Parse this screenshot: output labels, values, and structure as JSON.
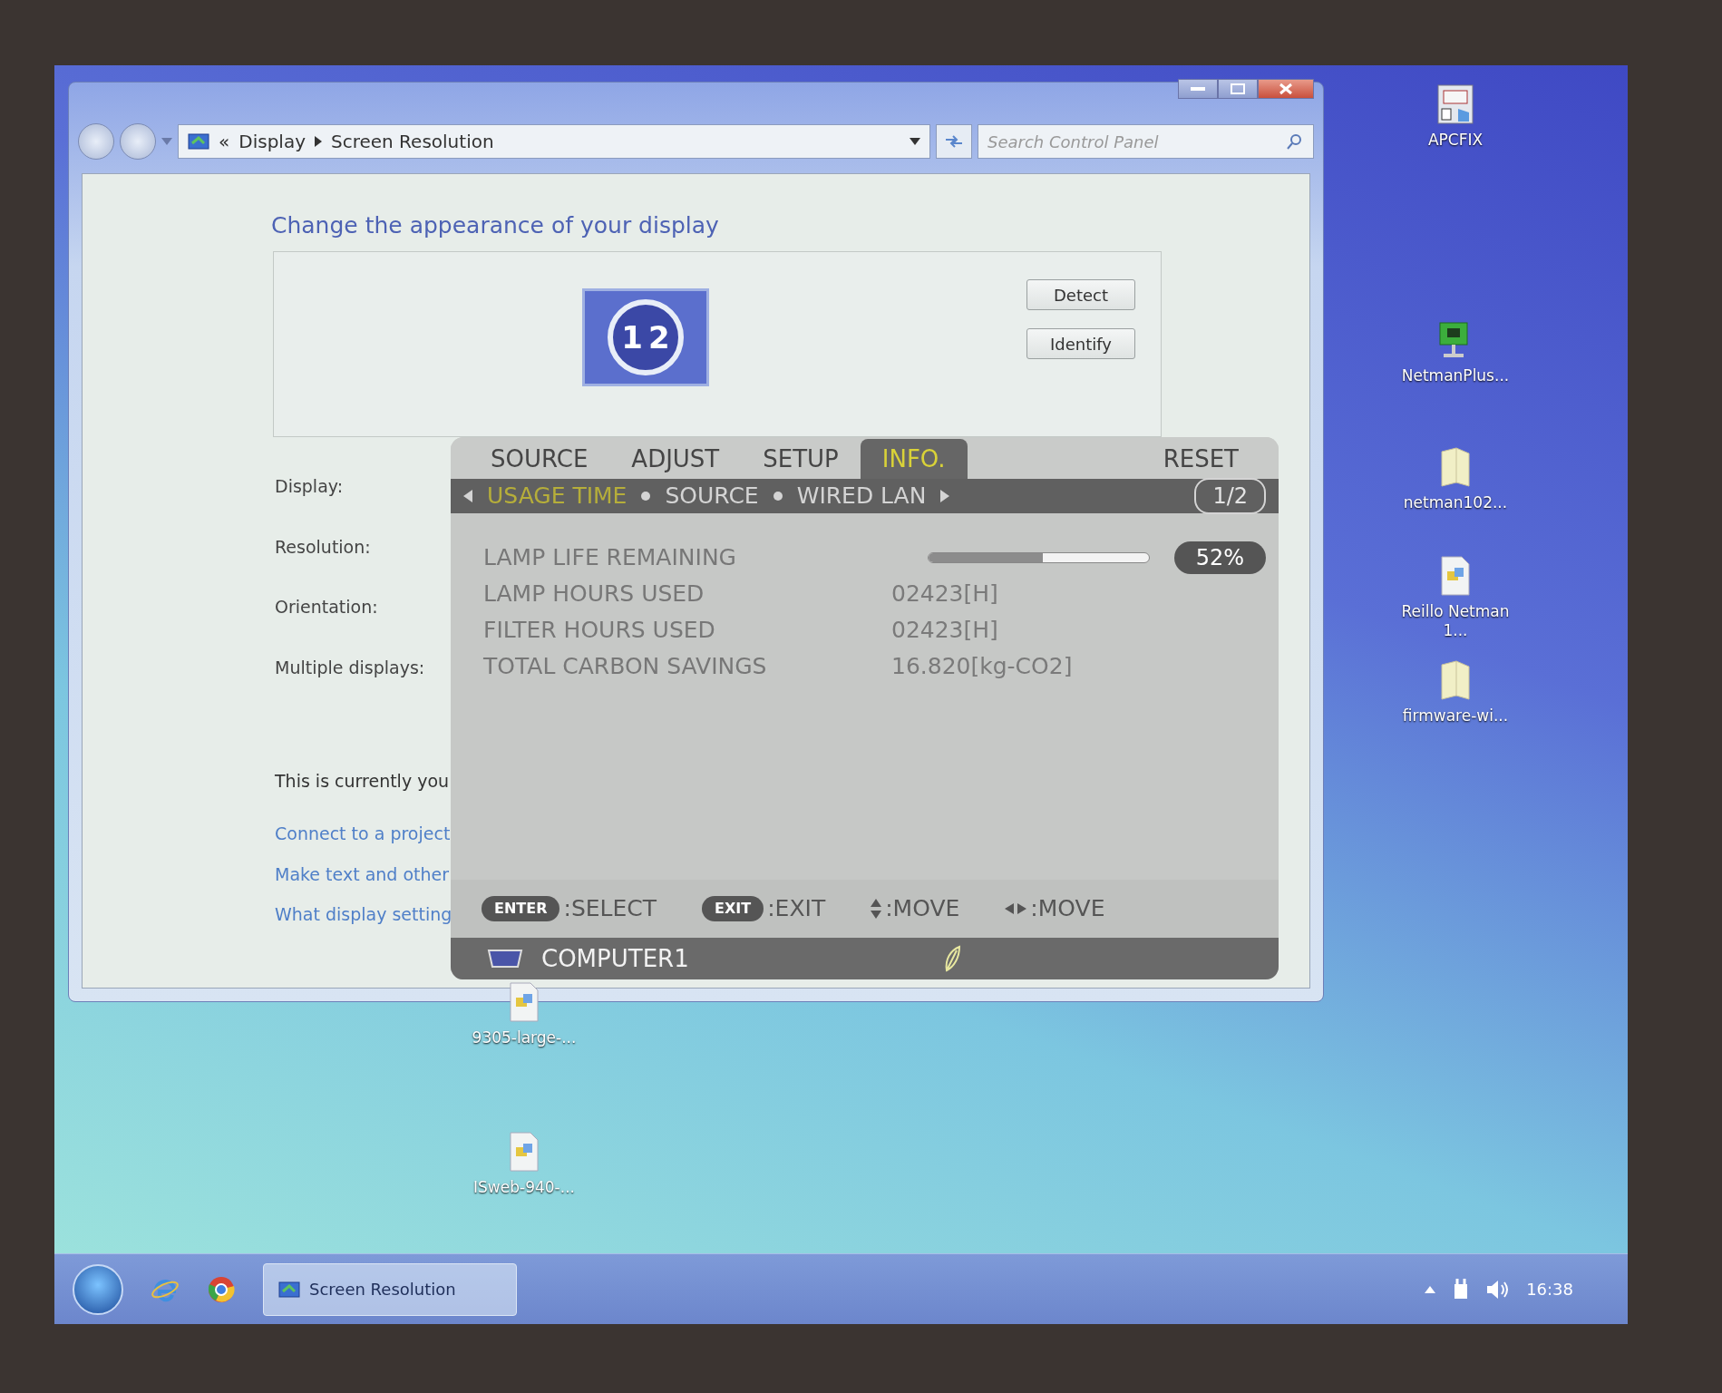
{
  "window": {
    "address": {
      "overflow_glyph": "«",
      "path": [
        "Display",
        "Screen Resolution"
      ]
    },
    "search": {
      "placeholder": "Search Control Panel"
    },
    "heading": "Change the appearance of your display",
    "monitor_numbers": [
      "1",
      "2"
    ],
    "buttons": [
      "Detect",
      "Identify"
    ],
    "form_labels": [
      "Display:",
      "Resolution:",
      "Orientation:",
      "Multiple displays:"
    ],
    "note": "This is currently you",
    "links": [
      "Connect to a project",
      "Make text and other",
      "What display setting"
    ]
  },
  "osd": {
    "tabs": [
      {
        "label": "SOURCE",
        "selected": false
      },
      {
        "label": "ADJUST",
        "selected": false
      },
      {
        "label": "SETUP",
        "selected": false
      },
      {
        "label": "INFO.",
        "selected": true
      },
      {
        "label": "RESET",
        "selected": false
      }
    ],
    "subtabs": [
      {
        "label": "USAGE TIME",
        "selected": true
      },
      {
        "label": "SOURCE",
        "selected": false
      },
      {
        "label": "WIRED LAN",
        "selected": false
      }
    ],
    "page": "1/2",
    "rows": [
      {
        "kind": "meter",
        "label": "LAMP LIFE REMAINING",
        "level": 0.52,
        "reading": "52%"
      },
      {
        "kind": "value",
        "label": "LAMP HOURS USED",
        "value": "02423[H]"
      },
      {
        "kind": "value",
        "label": "FILTER HOURS USED",
        "value": "02423[H]"
      },
      {
        "kind": "value",
        "label": "TOTAL CARBON SAVINGS",
        "value": "16.820[kg-CO2]"
      }
    ],
    "hints": [
      {
        "kind": "key",
        "key": "ENTER",
        "text": ":SELECT"
      },
      {
        "kind": "key",
        "key": "EXIT",
        "text": ":EXIT"
      },
      {
        "kind": "updown",
        "text": ":MOVE"
      },
      {
        "kind": "leftright",
        "text": ":MOVE"
      }
    ],
    "source": "COMPUTER1"
  },
  "desktop_icons": [
    {
      "kind": "app",
      "label": "APCFIX"
    },
    {
      "kind": "network",
      "label": "NetmanPlus..."
    },
    {
      "kind": "folder",
      "label": "netman102..."
    },
    {
      "kind": "file",
      "label": "Reillo Netman 1..."
    },
    {
      "kind": "folder",
      "label": "firmware-wi..."
    },
    {
      "kind": "file",
      "label": "9305-large-..."
    },
    {
      "kind": "file",
      "label": "ISweb-940-..."
    }
  ],
  "taskbar": {
    "task": "Screen Resolution",
    "clock": "16:38"
  }
}
